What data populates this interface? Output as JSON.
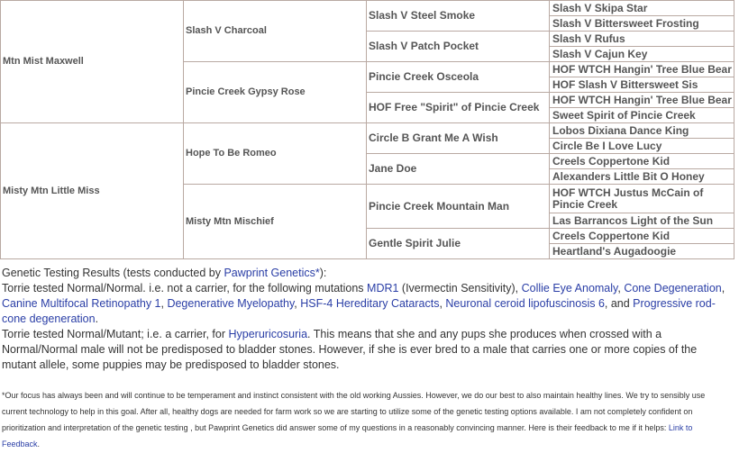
{
  "pedigree": {
    "gen1": [
      "Mtn Mist Maxwell",
      "Misty Mtn Little Miss"
    ],
    "gen2": [
      "Slash V Charcoal",
      "Pincie Creek Gypsy Rose",
      "Hope To Be Romeo",
      "Misty Mtn Mischief"
    ],
    "gen3": [
      "Slash V Steel Smoke",
      "Slash V Patch Pocket",
      "Pincie Creek Osceola",
      "HOF Free \"Spirit\" of Pincie Creek",
      "Circle B Grant Me A Wish",
      "Jane Doe",
      "Pincie Creek Mountain Man",
      "Gentle Spirit Julie"
    ],
    "gen4": [
      "Slash V Skipa Star",
      "Slash V Bittersweet Frosting",
      "Slash V Rufus",
      "Slash V Cajun Key",
      "HOF WTCH Hangin' Tree Blue Bear",
      "HOF Slash V Bittersweet Sis",
      "HOF WTCH Hangin' Tree Blue Bear",
      "Sweet Spirit of Pincie Creek",
      "Lobos Dixiana Dance King",
      "Circle Be I Love Lucy",
      "Creels Coppertone Kid",
      "Alexanders Little Bit O Honey",
      "HOF WTCH Justus McCain of Pincie Creek",
      "Las Barrancos Light of the Sun",
      "Creels Coppertone Kid",
      "Heartland's Augadoogie"
    ]
  },
  "genetics": {
    "intro": "Genetic Testing Results (tests conducted by ",
    "lab_link": "Pawprint Genetics*",
    "intro_end": "):",
    "p1_a": "Torrie tested Normal/Normal. i.e. not a carrier, for the following mutations ",
    "mdr1": "MDR1",
    "p1_b": " (Ivermectin Sensitivity), ",
    "cea": "Collie Eye Anomaly",
    "cd": "Cone Degeneration",
    "cmr1": "Canine Multifocal Retinopathy 1",
    "dm": "Degenerative Myelopathy",
    "hsf4": "HSF-4 Hereditary Cataracts",
    "ncl6": "Neuronal ceroid lipofuscinosis 6",
    "and": ", and ",
    "prcd": "Progressive rod-cone degeneration",
    "p2_a": "Torrie tested Normal/Mutant; i.e. a carrier, for ",
    "hyp": "Hyperuricosuria",
    "p2_b": ". This means that she and any pups she produces when crossed with a Normal/Normal male will not be predisposed to bladder stones.  However, if she is ever bred to a male that carries one or more copies of the mutant allele, some puppies may be predisposed to bladder stones.",
    "footnote": "*Our focus has always been and will continue to be temperament and instinct consistent with the old working Aussies. However, we do our best to also maintain healthy lines.  We try to sensibly use current technology to help in this goal.  After all, healthy dogs are needed for farm work so we are starting to utilize some of the genetic testing options available. I am not completely confident on prioritization and interpretation of the genetic testing , but Pawprint Genetics did answer some of my questions in a reasonably convincing manner. Here is their feedback to me if it helps: ",
    "feedback_link": "Link to Feedback",
    "footnote_end": "."
  }
}
